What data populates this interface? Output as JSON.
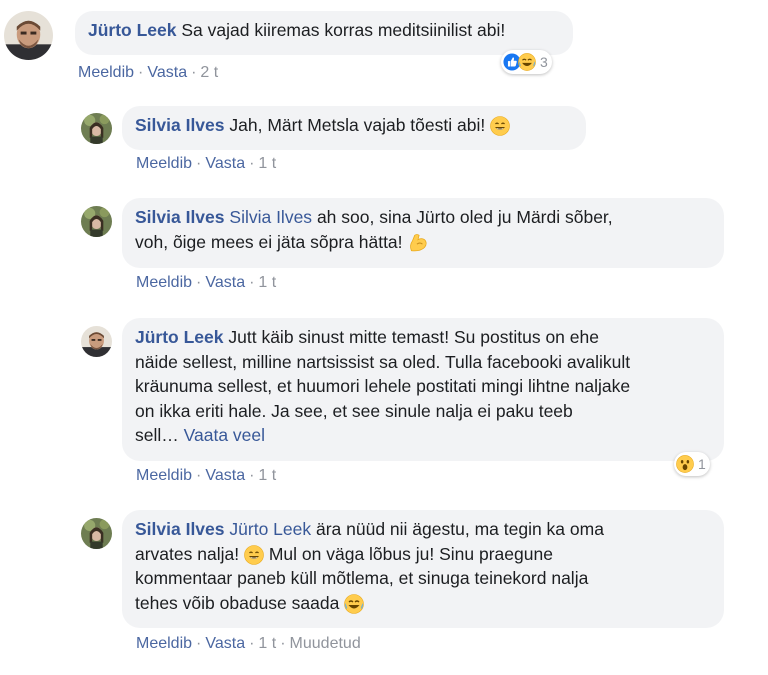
{
  "comments": [
    {
      "author": "Jürto Leek",
      "text": "Sa vajad kiiremas korras meditsiinilist abi!",
      "actions": {
        "like": "Meeldib",
        "reply": "Vasta",
        "time": "2 t"
      },
      "reaction_count": "3",
      "reactions": [
        "like-icon",
        "laughing-face-icon"
      ]
    },
    {
      "author": "Silvia Ilves",
      "text": "Jah, Märt Metsla vajab tõesti abi!",
      "emoji": "smiling-face-icon",
      "actions": {
        "like": "Meeldib",
        "reply": "Vasta",
        "time": "1 t"
      }
    },
    {
      "author": "Silvia Ilves",
      "mention": "Silvia Ilves",
      "text_line1": "ah soo, sina Jürto oled ju Märdi sõber,",
      "text_line2": "voh, õige mees ei jäta sõpra hätta!",
      "emoji": "flexed-biceps-icon",
      "actions": {
        "like": "Meeldib",
        "reply": "Vasta",
        "time": "1 t"
      }
    },
    {
      "author": "Jürto Leek",
      "text_line1": "Jutt käib sinust mitte temast! Su postitus on ehe",
      "text_line2": "näide sellest, milline nartsissist sa oled. Tulla facebooki avalikult",
      "text_line3": "kräunuma sellest, et huumori lehele postitati mingi lihtne naljake",
      "text_line4": "on ikka eriti hale. Ja see, et see sinule nalja ei paku teeb",
      "text_line5": "sell…",
      "see_more": "Vaata veel",
      "actions": {
        "like": "Meeldib",
        "reply": "Vasta",
        "time": "1 t"
      },
      "reaction_count": "1",
      "reactions": [
        "surprised-face-icon"
      ]
    },
    {
      "author": "Silvia Ilves",
      "mention": "Jürto Leek",
      "text_line1": "ära nüüd nii ägestu, ma tegin ka oma",
      "text_line2a": "arvates nalja!",
      "text_line2b": "Mul on väga lõbus ju! Sinu praegune",
      "text_line3": "kommentaar paneb küll mõtlema, et sinuga teinekord nalja",
      "text_line4": "tehes võib obaduse saada",
      "emojis": [
        "smiling-face-icon",
        "tears-of-joy-icon"
      ],
      "actions": {
        "like": "Meeldib",
        "reply": "Vasta",
        "time": "1 t",
        "edited": "Muudetud"
      }
    }
  ],
  "colors": {
    "link": "#385898",
    "bubble": "#f2f3f5",
    "meta": "#90949c",
    "like_blue": "#1877f2",
    "emoji_yellow": "#ffcc4d"
  }
}
